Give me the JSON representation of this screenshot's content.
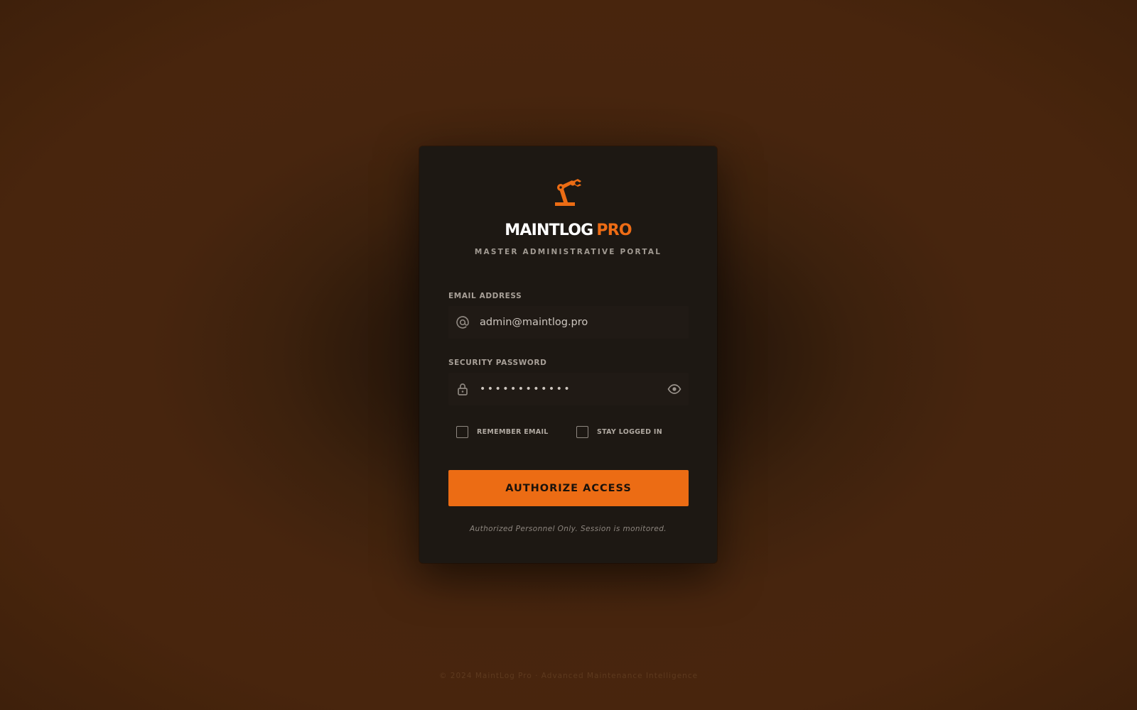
{
  "brand": {
    "name_main": "MAINTLOG",
    "name_accent": "PRO",
    "subtitle": "MASTER ADMINISTRATIVE PORTAL",
    "logo_icon": "robot-arm-icon",
    "accent_color": "#ec6c14"
  },
  "login_form": {
    "email_label": "EMAIL ADDRESS",
    "email_value": "admin@maintlog.pro",
    "email_icon": "at-sign-icon",
    "password_label": "SECURITY PASSWORD",
    "password_value": "••••••••••••",
    "password_icon": "lock-icon",
    "reveal_icon": "eye-icon",
    "remember_email_label": "REMEMBER EMAIL",
    "remember_email_checked": false,
    "stay_logged_in_label": "STAY LOGGED IN",
    "stay_logged_in_checked": false,
    "submit_label": "AUTHORIZE ACCESS",
    "notice": "Authorized Personnel Only. Session is monitored."
  },
  "footer": {
    "text": "© 2024 MaintLog Pro · Advanced Maintenance Intelligence"
  }
}
